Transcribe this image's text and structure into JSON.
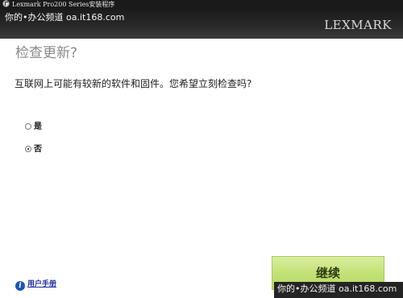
{
  "window": {
    "title": "Lexmark Pro200 Series安装程序",
    "icon": "installer-icon"
  },
  "header": {
    "watermark": "你的•办公频道 oa.it168.com",
    "logo": "LEXMARK"
  },
  "main": {
    "title": "检查更新?",
    "question": "互联网上可能有较新的软件和固件。您希望立刻检查吗?",
    "options": [
      {
        "label": "是",
        "checked": false
      },
      {
        "label": "否",
        "checked": true
      }
    ]
  },
  "footer": {
    "help_label": "用户手册",
    "help_icon": "info-icon",
    "continue_label": "继续",
    "watermark": "你的•办公频道 oa.it168.com"
  },
  "colors": {
    "header_bg": "#1b1b1b",
    "continue_bg": "#c4e176",
    "title_gray": "#8a8a8a",
    "link_blue": "#2030a0"
  }
}
